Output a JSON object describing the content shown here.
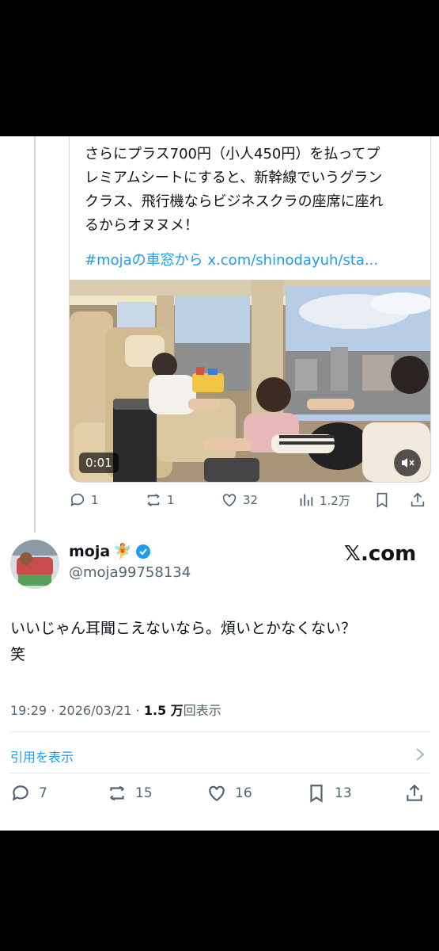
{
  "quoted": {
    "text": "さらにプラス700円（小人450円）を払ってプ\nレミアムシートにすると、新幹線でいうグラン\nクラス、飛行機ならビジネスクラの座席に座れ\nるからオヌヌメ！",
    "hashtag": "#mojaの車窓から",
    "link": "x.com/shinodayuh/sta...",
    "video_time": "0:01",
    "actions": {
      "replies": "1",
      "reposts": "1",
      "likes": "32",
      "views": "1.2万"
    }
  },
  "post": {
    "display_name": "moja",
    "emoji": "🧚",
    "handle": "@moja99758134",
    "brand": "𝕏.com",
    "text": "いいじゃん耳聞こえないなら。煩いとかなくない？\n笑",
    "time": "19:29",
    "date": "2026/03/21",
    "views_count": "1.5 万",
    "views_label": "回表示",
    "quote_link": "引用を表示",
    "actions": {
      "replies": "7",
      "reposts": "15",
      "likes": "16",
      "bookmarks": "13"
    }
  },
  "colors": {
    "accent": "#1d9bf0",
    "muted": "#536471",
    "verified": "#1d9bf0"
  }
}
